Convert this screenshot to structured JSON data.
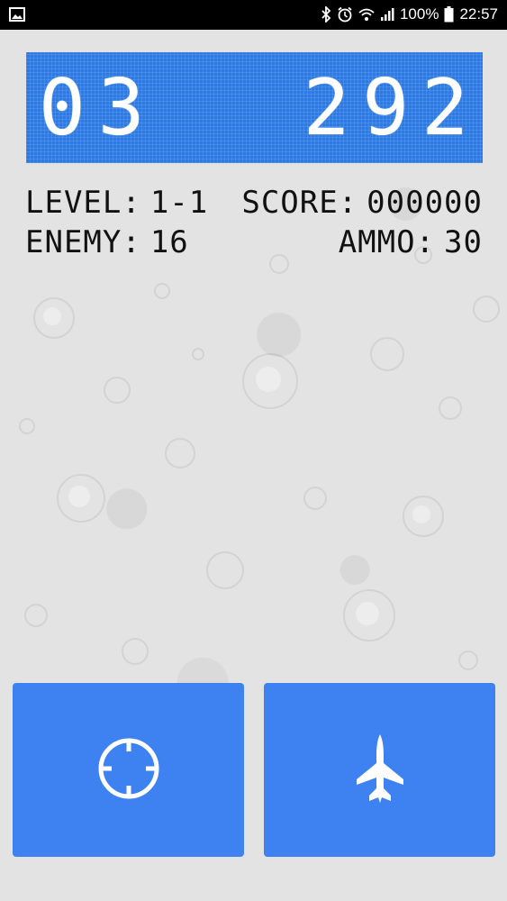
{
  "statusbar": {
    "battery_percent": "100%",
    "time": "22:57",
    "icons": [
      "image-icon",
      "bluetooth-icon",
      "alarm-icon",
      "wifi-icon",
      "signal-icon",
      "battery-icon"
    ]
  },
  "display": {
    "left_value": "03",
    "right_value": "292",
    "color": "#2f7ae0"
  },
  "stats": {
    "level_label": "LEVEL:",
    "level_value": "1-1",
    "score_label": "SCORE:",
    "score_value": "000000",
    "enemy_label": "ENEMY:",
    "enemy_value": "16",
    "ammo_label": "AMMO:",
    "ammo_value": "30"
  },
  "controls": {
    "aim_icon": "crosshair-icon",
    "fire_icon": "fighter-jet-icon",
    "button_color": "#3d82f0"
  }
}
